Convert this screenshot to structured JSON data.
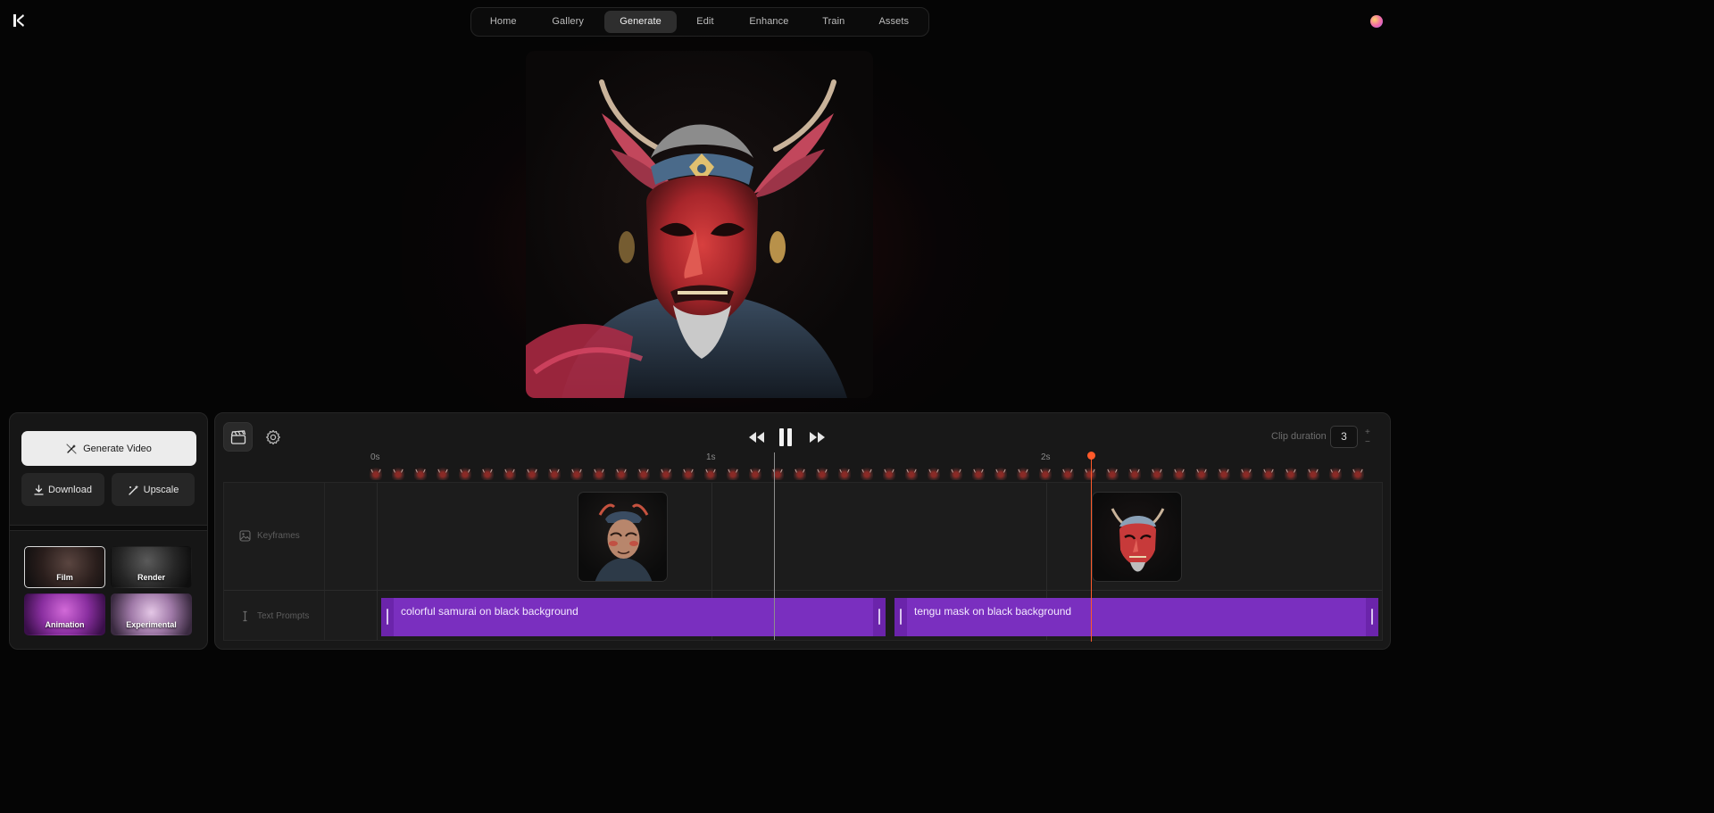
{
  "nav": {
    "items": [
      {
        "label": "Home"
      },
      {
        "label": "Gallery"
      },
      {
        "label": "Generate",
        "active": true
      },
      {
        "label": "Edit"
      },
      {
        "label": "Enhance"
      },
      {
        "label": "Train"
      },
      {
        "label": "Assets"
      }
    ]
  },
  "actions": {
    "generate_label": "Generate Video",
    "download_label": "Download",
    "upscale_label": "Upscale"
  },
  "styles": [
    {
      "label": "Film",
      "selected": true
    },
    {
      "label": "Render"
    },
    {
      "label": "Animation"
    },
    {
      "label": "Experimental"
    }
  ],
  "timeline": {
    "clip_duration_label": "Clip duration",
    "clip_duration_value": "3",
    "stepper_plus": "+",
    "stepper_minus": "−",
    "ruler": [
      "0s",
      "1s",
      "2s"
    ],
    "tracks": {
      "keyframes_label": "Keyframes",
      "prompts_label": "Text Prompts"
    },
    "prompts": [
      {
        "text": "colorful samurai on black background"
      },
      {
        "text": "tengu mask on black background"
      }
    ]
  },
  "colors": {
    "accent_purple": "#7a2fbf",
    "playhead": "#ff5a2a"
  }
}
